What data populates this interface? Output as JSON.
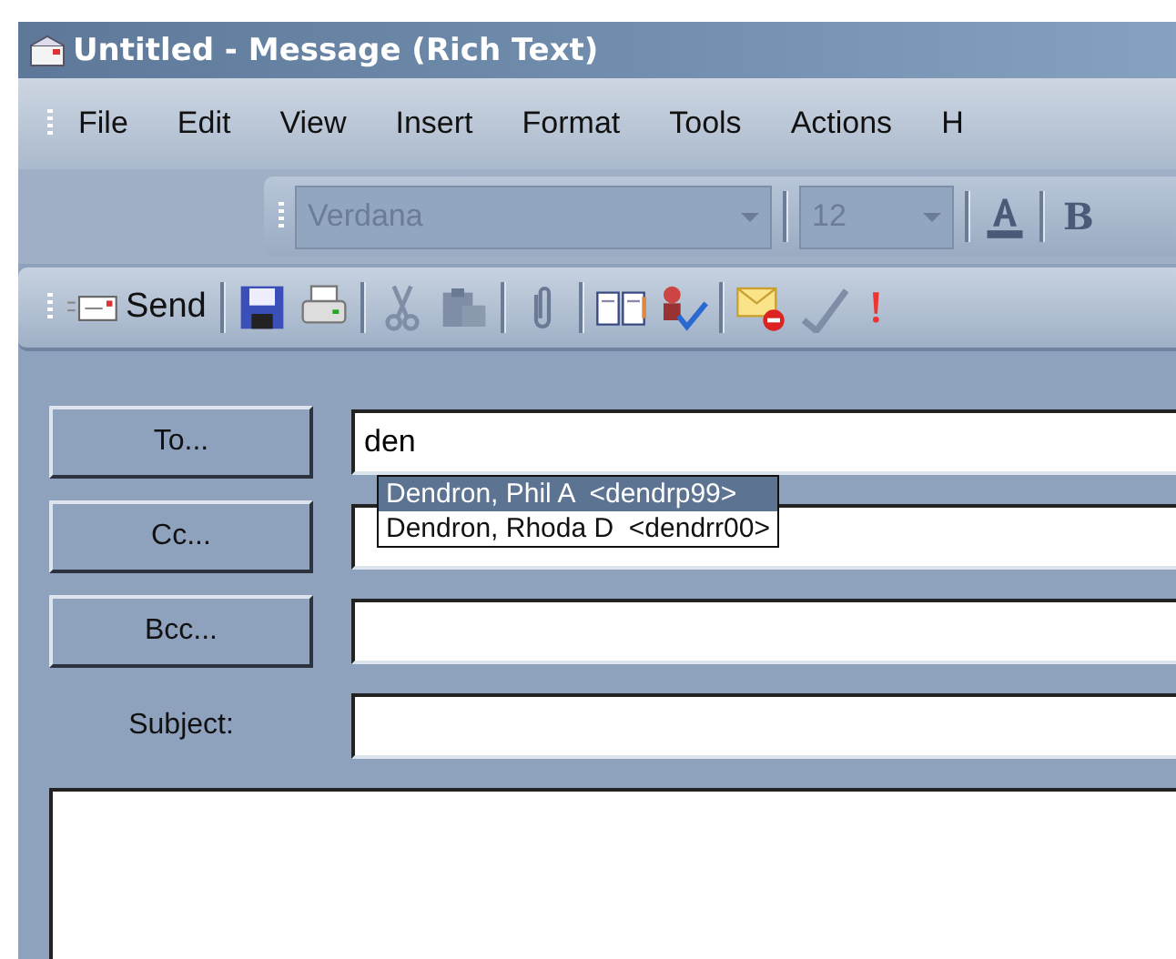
{
  "window": {
    "title": "Untitled - Message (Rich Text)"
  },
  "menu": [
    "File",
    "Edit",
    "View",
    "Insert",
    "Format",
    "Tools",
    "Actions",
    "H"
  ],
  "formatting_toolbar": {
    "font": "Verdana",
    "size": "12",
    "bold_label": "B"
  },
  "standard_toolbar": {
    "send_label": "Send"
  },
  "address_rows": [
    {
      "kind": "button",
      "label": "To...",
      "value": "den"
    },
    {
      "kind": "button",
      "label": "Cc...",
      "value": ""
    },
    {
      "kind": "button",
      "label": "Bcc...",
      "value": ""
    },
    {
      "kind": "label",
      "label": "Subject:",
      "value": ""
    }
  ],
  "autocomplete": [
    {
      "text": "Dendron, Phil A  <dendrp99>",
      "selected": true
    },
    {
      "text": "Dendron, Rhoda D  <dendrr00>",
      "selected": false
    }
  ]
}
